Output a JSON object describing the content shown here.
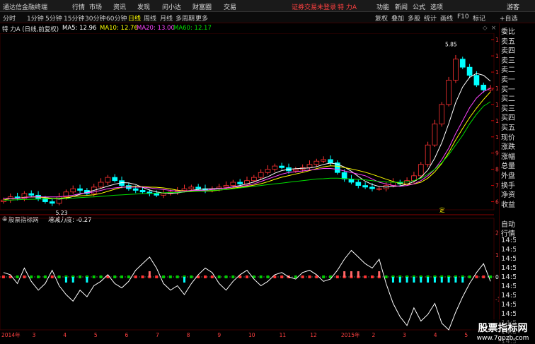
{
  "window": {
    "logo": "通达信金融终端",
    "menus": [
      "行情",
      "市场",
      "资讯",
      "发现",
      "问小达",
      "财富圈",
      "交易"
    ],
    "notice": "证券交易未登录",
    "stock": "特 力A",
    "right_menus": [
      "功能",
      "新闻",
      "公式",
      "选项"
    ],
    "user": "游客"
  },
  "toolbar": {
    "periods": [
      "分时",
      "1分钟",
      "5分钟",
      "15分钟",
      "30分钟",
      "60分钟",
      "日线",
      "周线",
      "月线",
      "多周期",
      "更多"
    ],
    "active": "日线",
    "tools": [
      "复权",
      "叠加",
      "多股",
      "统计",
      "画线",
      "F10",
      "标记"
    ],
    "self_select": "+自选"
  },
  "chart_info": {
    "title": "特 力A (日线,前复权)",
    "ma": [
      {
        "label": "MA5: 12.96",
        "color": "#ffffff"
      },
      {
        "label": "MA10: 12.76",
        "color": "#ffff00"
      },
      {
        "label": "MA20: 13.00",
        "color": "#ff44ff"
      },
      {
        "label": "MA60: 12.17",
        "color": "#00dd00"
      }
    ]
  },
  "indicator": {
    "name": "股票指标网",
    "label": "增减力度: -0.27"
  },
  "quote_panel": {
    "items": [
      "委比",
      "卖五",
      "卖四",
      "卖三",
      "卖二",
      "卖一",
      "买一",
      "买二",
      "买三",
      "买四",
      "买五",
      "现价",
      "涨跌",
      "涨幅",
      "总量",
      "外盘",
      "换手",
      "净资",
      "收益"
    ],
    "lower": [
      "自动",
      "行情",
      "14:5",
      "14:5",
      "14:5",
      "14:5",
      "14:5",
      "14:5",
      "14:5",
      "14:5",
      "14:5",
      "14:5",
      "14:5",
      "14:5"
    ]
  },
  "x_axis": {
    "labels": [
      "2014年",
      "3",
      "4",
      "5",
      "6",
      "7",
      "8",
      "9",
      "10",
      "11",
      "12",
      "2015年",
      "2",
      "3",
      "4",
      "5"
    ]
  },
  "watermark": {
    "text": "股票指标网",
    "url": "www.7gpzb.com"
  },
  "chart_data": [
    {
      "type": "candlestick",
      "y_axis": {
        "ticks": [
          "16.00",
          "15.00",
          "14.00",
          "13.00",
          "12.00",
          "11.00",
          "10.00",
          "9.00",
          "8.00",
          "7.00",
          "6.00"
        ],
        "range": [
          5.5,
          16.4
        ]
      },
      "annotations": {
        "high": "5.85",
        "low": "5.23",
        "tag": "定"
      },
      "close": [
        6.1,
        6.3,
        6.2,
        6.5,
        6.4,
        6.2,
        6.0,
        5.9,
        6.3,
        6.6,
        6.8,
        6.7,
        6.5,
        6.9,
        7.2,
        7.5,
        7.3,
        7.0,
        6.8,
        6.7,
        6.6,
        6.5,
        6.4,
        6.5,
        6.6,
        6.7,
        6.8,
        6.9,
        6.8,
        6.7,
        6.8,
        6.9,
        7.0,
        7.2,
        7.1,
        7.3,
        7.5,
        7.8,
        8.0,
        8.2,
        8.1,
        7.9,
        8.0,
        8.1,
        8.3,
        8.5,
        8.6,
        8.4,
        7.8,
        7.4,
        7.2,
        7.0,
        6.9,
        6.8,
        6.8,
        7.0,
        7.2,
        7.1,
        7.3,
        7.6,
        8.3,
        9.5,
        10.8,
        12.0,
        13.5,
        14.8,
        14.3,
        13.8,
        13.2,
        12.9,
        13.0
      ],
      "ma20": [
        6.2,
        6.2,
        6.2,
        6.25,
        6.3,
        6.3,
        6.3,
        6.3,
        6.3,
        6.35,
        6.4,
        6.5,
        6.55,
        6.6,
        6.7,
        6.8,
        6.85,
        6.9,
        6.9,
        6.9,
        6.9,
        6.85,
        6.8,
        6.75,
        6.7,
        6.65,
        6.65,
        6.7,
        6.7,
        6.7,
        6.75,
        6.8,
        6.85,
        6.9,
        6.95,
        7.0,
        7.1,
        7.25,
        7.4,
        7.55,
        7.7,
        7.8,
        7.85,
        7.9,
        7.95,
        8.0,
        8.05,
        8.05,
        8.0,
        7.9,
        7.8,
        7.7,
        7.6,
        7.4,
        7.2,
        7.1,
        7.0,
        6.95,
        7.0,
        7.1,
        7.3,
        7.6,
        8.0,
        8.6,
        9.3,
        10.2,
        11.0,
        11.8,
        12.4,
        12.8,
        13.0
      ],
      "ma60": [
        6.1,
        6.1,
        6.12,
        6.14,
        6.15,
        6.16,
        6.17,
        6.18,
        6.19,
        6.2,
        6.22,
        6.25,
        6.28,
        6.3,
        6.33,
        6.36,
        6.4,
        6.42,
        6.45,
        6.47,
        6.5,
        6.52,
        6.53,
        6.55,
        6.57,
        6.58,
        6.6,
        6.62,
        6.65,
        6.67,
        6.7,
        6.72,
        6.75,
        6.8,
        6.85,
        6.9,
        6.95,
        7.0,
        7.05,
        7.1,
        7.15,
        7.2,
        7.25,
        7.3,
        7.35,
        7.4,
        7.42,
        7.45,
        7.45,
        7.43,
        7.4,
        7.38,
        7.35,
        7.3,
        7.25,
        7.22,
        7.2,
        7.2,
        7.22,
        7.3,
        7.45,
        7.7,
        8.0,
        8.4,
        8.9,
        9.5,
        10.1,
        10.8,
        11.4,
        11.9,
        12.17
      ]
    },
    {
      "type": "line",
      "y_axis": {
        "ticks": [
          "20.00",
          "10.00",
          "0.00",
          "-10.00"
        ],
        "range": [
          -24,
          24
        ]
      },
      "values": [
        2,
        1,
        -3,
        4,
        -2,
        -6,
        -3,
        3,
        -4,
        -8,
        -11,
        -6,
        -9,
        -4,
        -2,
        1,
        -3,
        -5,
        -2,
        3,
        6,
        9,
        4,
        -3,
        -6,
        -4,
        -8,
        -3,
        1,
        4,
        2,
        -3,
        -6,
        -2,
        1,
        3,
        -1,
        -4,
        -2,
        1,
        2,
        0,
        -1,
        2,
        3,
        1,
        -2,
        -1,
        3,
        8,
        12,
        9,
        6,
        4,
        8,
        -3,
        -12,
        -18,
        -22,
        -14,
        -20,
        -17,
        -12,
        -21,
        -24,
        -16,
        -9,
        -3,
        2,
        6,
        -2
      ]
    }
  ]
}
